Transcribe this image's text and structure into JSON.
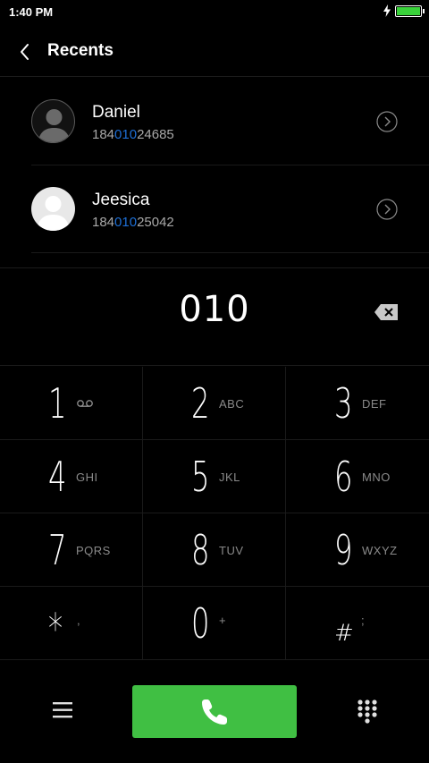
{
  "status_bar": {
    "time": "1:40 PM",
    "battery_level": 1.0,
    "battery_color": "#39d23a",
    "icons": [
      "charging-icon",
      "battery-icon"
    ]
  },
  "header": {
    "title": "Recents",
    "back_icon": "chevron-left-icon"
  },
  "contacts": [
    {
      "name": "Daniel",
      "number_prefix": "184",
      "number_match": "010",
      "number_suffix": "24685",
      "avatar": "dark-person-avatar",
      "detail_icon": "chevron-right-circle-icon"
    },
    {
      "name": "Jeesica",
      "number_prefix": "184",
      "number_match": "010",
      "number_suffix": "25042",
      "avatar": "light-person-avatar",
      "detail_icon": "chevron-right-circle-icon"
    }
  ],
  "display": {
    "digits": "010",
    "backspace_icon": "backspace-icon"
  },
  "keypad": [
    {
      "digit": "1",
      "letters": "",
      "icon": "voicemail-icon"
    },
    {
      "digit": "2",
      "letters": "ABC"
    },
    {
      "digit": "3",
      "letters": "DEF"
    },
    {
      "digit": "4",
      "letters": "GHI"
    },
    {
      "digit": "5",
      "letters": "JKL"
    },
    {
      "digit": "6",
      "letters": "MNO"
    },
    {
      "digit": "7",
      "letters": "PQRS"
    },
    {
      "digit": "8",
      "letters": "TUV"
    },
    {
      "digit": "9",
      "letters": "WXYZ"
    },
    {
      "digit": "*",
      "letters": ","
    },
    {
      "digit": "0",
      "letters": "+"
    },
    {
      "digit": "#",
      "letters": ";"
    }
  ],
  "bottom_bar": {
    "menu_icon": "hamburger-menu-icon",
    "call_icon": "phone-icon",
    "call_color": "#40bf43",
    "dialpad_icon": "dialpad-icon"
  },
  "colors": {
    "match_highlight": "#1e6fd6",
    "background": "#000000"
  }
}
